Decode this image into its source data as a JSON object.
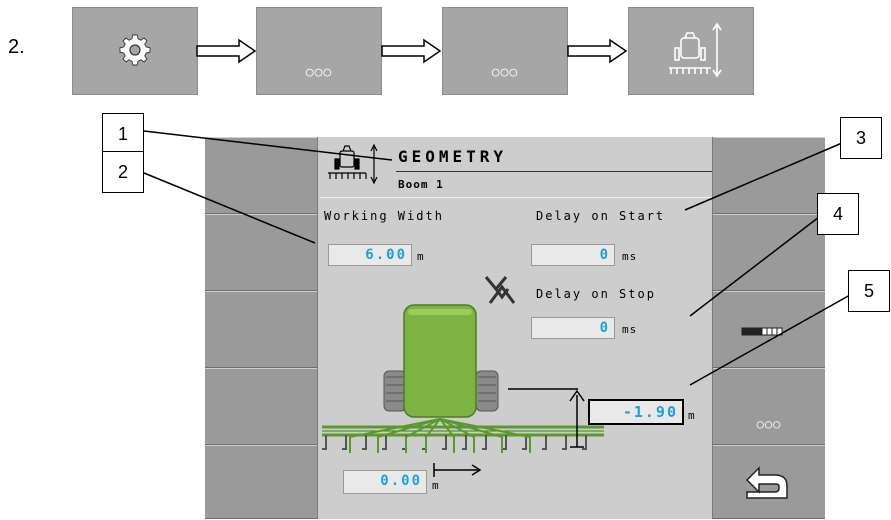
{
  "step_number": "2.",
  "toolbar": {
    "ellipsis_1": "○○○",
    "ellipsis_2": "○○○"
  },
  "screen": {
    "title": "GEOMETRY",
    "subtitle": "Boom 1",
    "working_width": {
      "label": "Working Width",
      "value": "6.00",
      "unit": "m"
    },
    "delay_on_start": {
      "label": "Delay on Start",
      "value": "0",
      "unit": "ms"
    },
    "delay_on_stop": {
      "label": "Delay on Stop",
      "value": "0",
      "unit": "ms"
    },
    "height_offset": {
      "value": "-1.90",
      "unit": "m"
    },
    "lateral_offset": {
      "value": "0.00",
      "unit": "m"
    }
  },
  "softkeys": {
    "more_label": "○○○"
  },
  "callouts": [
    "1",
    "2",
    "3",
    "4",
    "5"
  ],
  "colors": {
    "value_text": "#1fa0d8",
    "machine_green": "#7cb342",
    "boom_green": "#5a9a2a"
  }
}
